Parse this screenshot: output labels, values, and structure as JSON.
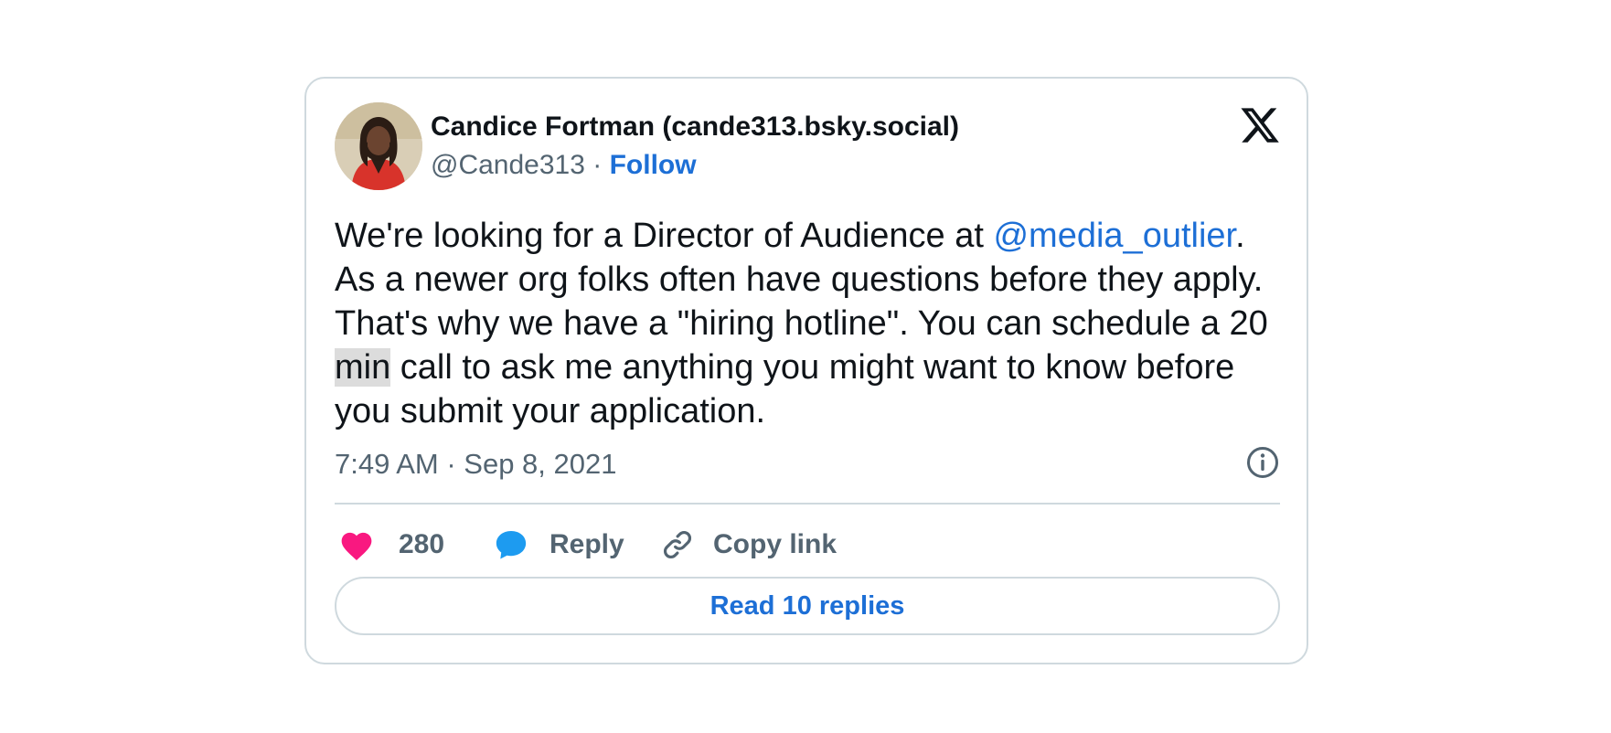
{
  "author": {
    "display_name": "Candice Fortman (cande313.bsky.social)",
    "handle": "@Cande313",
    "separator": " · ",
    "follow_label": "Follow"
  },
  "tweet": {
    "text_part1": "We're looking for a Director of Audience at ",
    "mention": "@media_outlier",
    "text_part2": ". As a newer org folks often have questions before they apply. That's why we have a \"hiring hotline\". You can schedule a 20 ",
    "highlighted_word": "min",
    "text_part3": " call to ask me anything you might want to know before you submit your application.",
    "timestamp": "7:49 AM · Sep 8, 2021"
  },
  "actions": {
    "like_count": "280",
    "reply_label": "Reply",
    "copy_link_label": "Copy link"
  },
  "read_replies_label": "Read 10 replies",
  "colors": {
    "link": "#1d6fd6",
    "heart": "#f91880",
    "reply_bubble": "#1d9bf0",
    "secondary_text": "#536471",
    "border": "#cfd9de"
  },
  "icons": [
    "avatar",
    "x-logo-icon",
    "info-icon",
    "heart-icon",
    "reply-bubble-icon",
    "link-icon"
  ]
}
